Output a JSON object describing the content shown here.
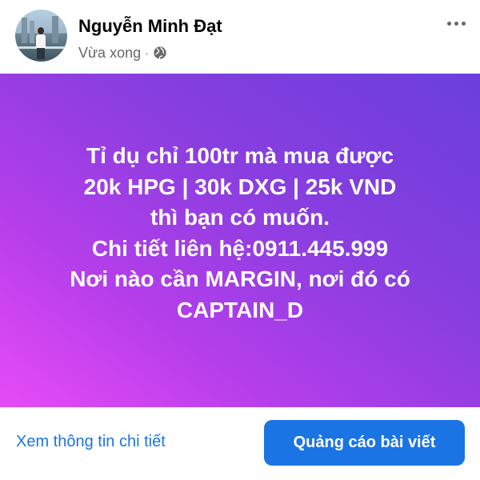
{
  "post": {
    "author_name": "Nguyễn Minh Đạt",
    "timestamp": "Vừa xong",
    "separator": "·",
    "audience_icon": "globe-icon",
    "more_icon": "more-horizontal-icon",
    "background_colors": [
      "#e64bf6",
      "#b43eea",
      "#8a3ee0",
      "#6a3fdc"
    ],
    "text_lines": [
      "Tỉ dụ chỉ 100tr mà mua được",
      "20k HPG | 30k DXG | 25k VND",
      "thì bạn có muốn.",
      "Chi tiết liên hệ:0911.445.999",
      "Nơi nào cần MARGIN, nơi đó có",
      "CAPTAIN_D"
    ]
  },
  "footer": {
    "details_link": "Xem thông tin chi tiết",
    "boost_button": "Quảng cáo bài viết",
    "accent_color": "#1b74e4"
  }
}
